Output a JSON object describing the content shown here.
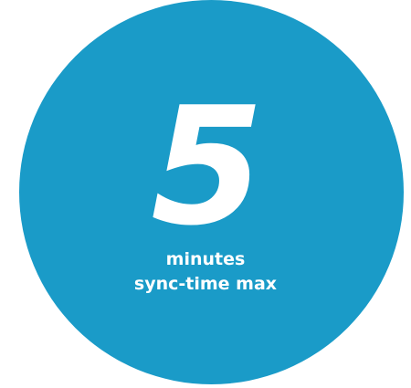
{
  "badge": {
    "number": "5",
    "line1": "minutes",
    "line2": "sync-time max",
    "color": "#1a9bc8",
    "text_color": "#ffffff"
  }
}
